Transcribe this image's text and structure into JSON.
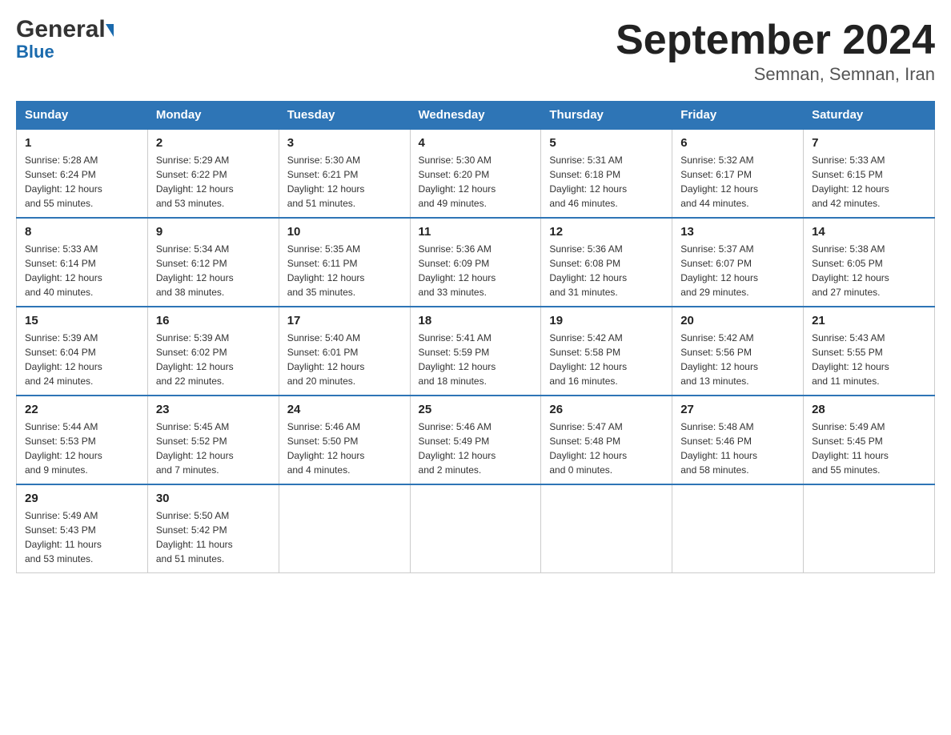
{
  "header": {
    "logo_general": "General",
    "logo_blue": "Blue",
    "title": "September 2024",
    "subtitle": "Semnan, Semnan, Iran"
  },
  "weekdays": [
    "Sunday",
    "Monday",
    "Tuesday",
    "Wednesday",
    "Thursday",
    "Friday",
    "Saturday"
  ],
  "weeks": [
    [
      {
        "day": "1",
        "info": "Sunrise: 5:28 AM\nSunset: 6:24 PM\nDaylight: 12 hours\nand 55 minutes."
      },
      {
        "day": "2",
        "info": "Sunrise: 5:29 AM\nSunset: 6:22 PM\nDaylight: 12 hours\nand 53 minutes."
      },
      {
        "day": "3",
        "info": "Sunrise: 5:30 AM\nSunset: 6:21 PM\nDaylight: 12 hours\nand 51 minutes."
      },
      {
        "day": "4",
        "info": "Sunrise: 5:30 AM\nSunset: 6:20 PM\nDaylight: 12 hours\nand 49 minutes."
      },
      {
        "day": "5",
        "info": "Sunrise: 5:31 AM\nSunset: 6:18 PM\nDaylight: 12 hours\nand 46 minutes."
      },
      {
        "day": "6",
        "info": "Sunrise: 5:32 AM\nSunset: 6:17 PM\nDaylight: 12 hours\nand 44 minutes."
      },
      {
        "day": "7",
        "info": "Sunrise: 5:33 AM\nSunset: 6:15 PM\nDaylight: 12 hours\nand 42 minutes."
      }
    ],
    [
      {
        "day": "8",
        "info": "Sunrise: 5:33 AM\nSunset: 6:14 PM\nDaylight: 12 hours\nand 40 minutes."
      },
      {
        "day": "9",
        "info": "Sunrise: 5:34 AM\nSunset: 6:12 PM\nDaylight: 12 hours\nand 38 minutes."
      },
      {
        "day": "10",
        "info": "Sunrise: 5:35 AM\nSunset: 6:11 PM\nDaylight: 12 hours\nand 35 minutes."
      },
      {
        "day": "11",
        "info": "Sunrise: 5:36 AM\nSunset: 6:09 PM\nDaylight: 12 hours\nand 33 minutes."
      },
      {
        "day": "12",
        "info": "Sunrise: 5:36 AM\nSunset: 6:08 PM\nDaylight: 12 hours\nand 31 minutes."
      },
      {
        "day": "13",
        "info": "Sunrise: 5:37 AM\nSunset: 6:07 PM\nDaylight: 12 hours\nand 29 minutes."
      },
      {
        "day": "14",
        "info": "Sunrise: 5:38 AM\nSunset: 6:05 PM\nDaylight: 12 hours\nand 27 minutes."
      }
    ],
    [
      {
        "day": "15",
        "info": "Sunrise: 5:39 AM\nSunset: 6:04 PM\nDaylight: 12 hours\nand 24 minutes."
      },
      {
        "day": "16",
        "info": "Sunrise: 5:39 AM\nSunset: 6:02 PM\nDaylight: 12 hours\nand 22 minutes."
      },
      {
        "day": "17",
        "info": "Sunrise: 5:40 AM\nSunset: 6:01 PM\nDaylight: 12 hours\nand 20 minutes."
      },
      {
        "day": "18",
        "info": "Sunrise: 5:41 AM\nSunset: 5:59 PM\nDaylight: 12 hours\nand 18 minutes."
      },
      {
        "day": "19",
        "info": "Sunrise: 5:42 AM\nSunset: 5:58 PM\nDaylight: 12 hours\nand 16 minutes."
      },
      {
        "day": "20",
        "info": "Sunrise: 5:42 AM\nSunset: 5:56 PM\nDaylight: 12 hours\nand 13 minutes."
      },
      {
        "day": "21",
        "info": "Sunrise: 5:43 AM\nSunset: 5:55 PM\nDaylight: 12 hours\nand 11 minutes."
      }
    ],
    [
      {
        "day": "22",
        "info": "Sunrise: 5:44 AM\nSunset: 5:53 PM\nDaylight: 12 hours\nand 9 minutes."
      },
      {
        "day": "23",
        "info": "Sunrise: 5:45 AM\nSunset: 5:52 PM\nDaylight: 12 hours\nand 7 minutes."
      },
      {
        "day": "24",
        "info": "Sunrise: 5:46 AM\nSunset: 5:50 PM\nDaylight: 12 hours\nand 4 minutes."
      },
      {
        "day": "25",
        "info": "Sunrise: 5:46 AM\nSunset: 5:49 PM\nDaylight: 12 hours\nand 2 minutes."
      },
      {
        "day": "26",
        "info": "Sunrise: 5:47 AM\nSunset: 5:48 PM\nDaylight: 12 hours\nand 0 minutes."
      },
      {
        "day": "27",
        "info": "Sunrise: 5:48 AM\nSunset: 5:46 PM\nDaylight: 11 hours\nand 58 minutes."
      },
      {
        "day": "28",
        "info": "Sunrise: 5:49 AM\nSunset: 5:45 PM\nDaylight: 11 hours\nand 55 minutes."
      }
    ],
    [
      {
        "day": "29",
        "info": "Sunrise: 5:49 AM\nSunset: 5:43 PM\nDaylight: 11 hours\nand 53 minutes."
      },
      {
        "day": "30",
        "info": "Sunrise: 5:50 AM\nSunset: 5:42 PM\nDaylight: 11 hours\nand 51 minutes."
      },
      {
        "day": "",
        "info": ""
      },
      {
        "day": "",
        "info": ""
      },
      {
        "day": "",
        "info": ""
      },
      {
        "day": "",
        "info": ""
      },
      {
        "day": "",
        "info": ""
      }
    ]
  ]
}
